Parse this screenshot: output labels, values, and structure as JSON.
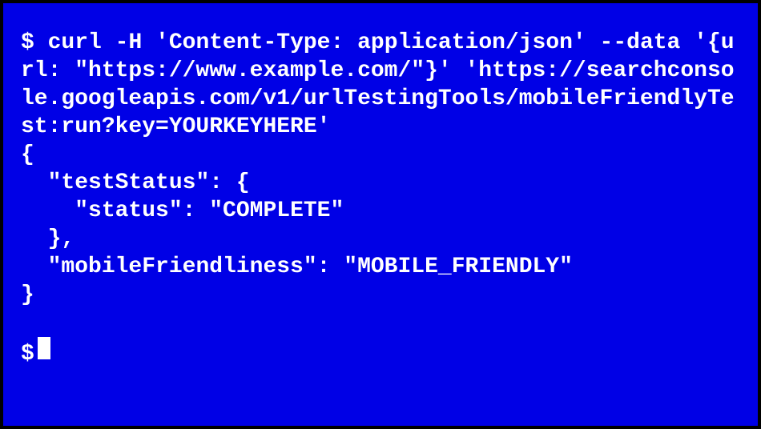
{
  "terminal": {
    "prompt": "$",
    "command": "curl -H 'Content-Type: application/json' --data '{url: \"https://www.example.com/\"}' 'https://searchconsole.googleapis.com/v1/urlTestingTools/mobileFriendlyTest:run?key=YOURKEYHERE'",
    "output_lines": [
      "{",
      "  \"testStatus\": {",
      "    \"status\": \"COMPLETE\"",
      "  },",
      "  \"mobileFriendliness\": \"MOBILE_FRIENDLY\"",
      "}"
    ],
    "prompt2": "$"
  }
}
